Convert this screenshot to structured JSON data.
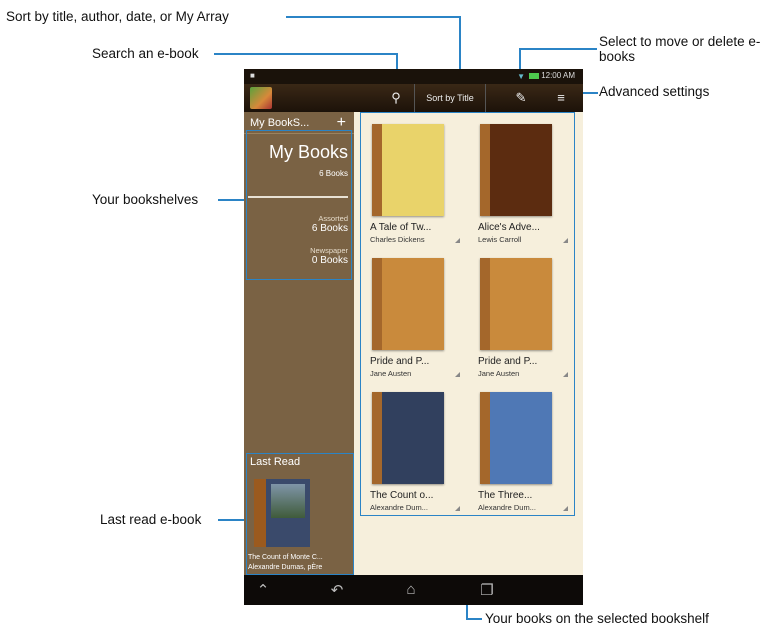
{
  "callouts": {
    "sort": "Sort by title, author, date, or My Array",
    "search": "Search an e-book",
    "select": "Select to move or delete e-books",
    "advanced": "Advanced settings",
    "bookshelves": "Your bookshelves",
    "last_read": "Last read e-book",
    "books_shelf": "Your books on the selected bookshelf"
  },
  "status_bar": {
    "time": "12:00 AM"
  },
  "action_bar": {
    "search_icon": "search-icon",
    "sort_label": "Sort by Title",
    "edit_icon": "pencil-icon",
    "menu_icon": "menu-icon"
  },
  "sidebar": {
    "header": "My BookS...",
    "add_label": "+",
    "current_shelf": {
      "name": "My Books",
      "count": "6 Books"
    },
    "shelves": [
      {
        "name": "Assorted",
        "count": "6 Books"
      },
      {
        "name": "Newspaper",
        "count": "0 Books"
      }
    ],
    "last_read_label": "Last Read",
    "last_read_book": {
      "title": "The Count of Monte C...",
      "author": "Alexandre Dumas, pÈre"
    }
  },
  "books": [
    {
      "title": "A Tale of Tw...",
      "author": "Charles Dickens",
      "color": "#e9d36a"
    },
    {
      "title": "Alice's Adve...",
      "author": "Lewis Carroll",
      "color": "#5c2c10"
    },
    {
      "title": "Pride and P...",
      "author": "Jane Austen",
      "color": "#c98a3c"
    },
    {
      "title": "Pride and P...",
      "author": "Jane Austen",
      "color": "#c98a3c"
    },
    {
      "title": "The Count o...",
      "author": "Alexandre Dum...",
      "color": "#31405e"
    },
    {
      "title": "The Three...",
      "author": "Alexandre Dum...",
      "color": "#4f78b5"
    }
  ]
}
